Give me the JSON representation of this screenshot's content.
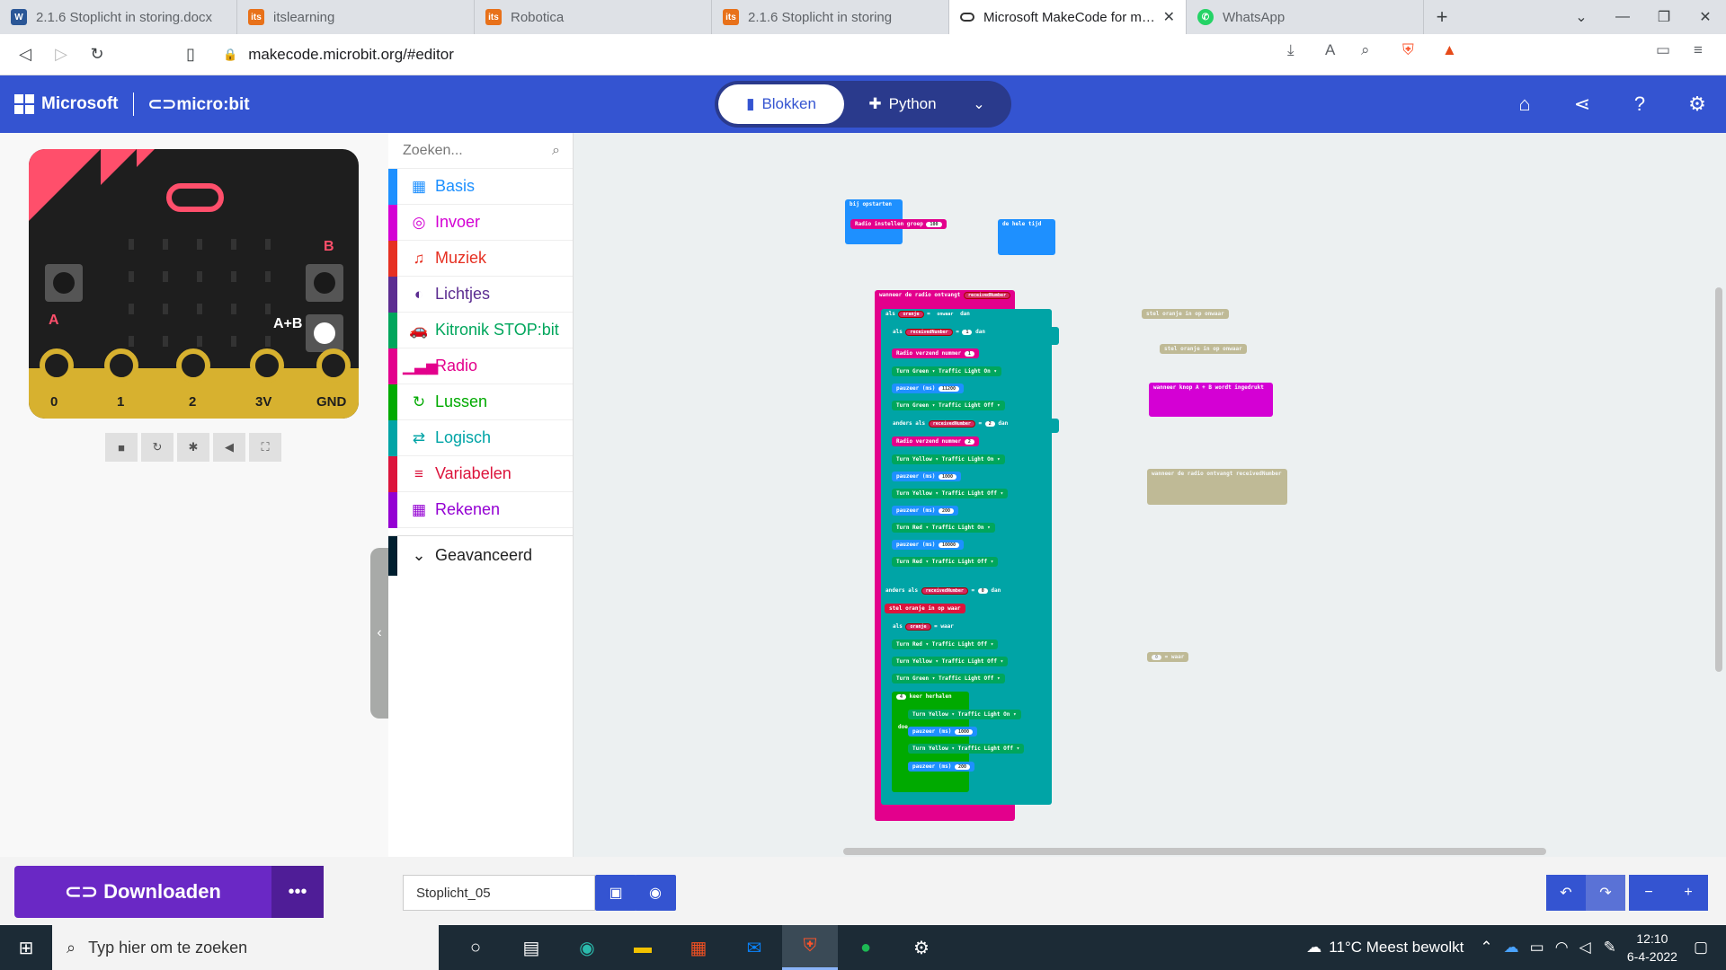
{
  "browser": {
    "tabs": [
      {
        "title": "2.1.6 Stoplicht in storing.docx",
        "icon": "W",
        "color": "#2b5797"
      },
      {
        "title": "itslearning",
        "icon": "its",
        "color": "#e8711a"
      },
      {
        "title": "Robotica",
        "icon": "its",
        "color": "#e8711a"
      },
      {
        "title": "2.1.6 Stoplicht in storing",
        "icon": "its",
        "color": "#e8711a"
      },
      {
        "title": "Microsoft MakeCode for micro:bit",
        "icon": "mc",
        "color": "#fff",
        "active": true
      },
      {
        "title": "WhatsApp",
        "icon": "wa",
        "color": "#25d366"
      }
    ],
    "url": "makecode.microbit.org/#editor"
  },
  "header": {
    "microsoft": "Microsoft",
    "microbit": "micro:bit",
    "blocks_label": "Blokken",
    "python_label": "Python"
  },
  "simulator": {
    "pin_labels": [
      "0",
      "1",
      "2",
      "3V",
      "GND"
    ],
    "button_a": "A",
    "button_b": "B",
    "button_ab": "A+B"
  },
  "toolbox": {
    "search_placeholder": "Zoeken...",
    "categories": [
      {
        "label": "Basis",
        "color": "#1e90ff",
        "icon": "grid-icon"
      },
      {
        "label": "Invoer",
        "color": "#d400d4",
        "icon": "target-icon"
      },
      {
        "label": "Muziek",
        "color": "#e63022",
        "icon": "headphones-icon"
      },
      {
        "label": "Lichtjes",
        "color": "#5c2d91",
        "icon": "toggle-icon"
      },
      {
        "label": "Kitronik STOP:bit",
        "color": "#00a65c",
        "icon": "car-icon"
      },
      {
        "label": "Radio",
        "color": "#e3008c",
        "icon": "signal-icon"
      },
      {
        "label": "Lussen",
        "color": "#00aa00",
        "icon": "loop-icon"
      },
      {
        "label": "Logisch",
        "color": "#00a4a6",
        "icon": "shuffle-icon"
      },
      {
        "label": "Variabelen",
        "color": "#dc143c",
        "icon": "lines-icon"
      },
      {
        "label": "Rekenen",
        "color": "#9400d3",
        "icon": "calculator-icon"
      }
    ],
    "advanced": "Geavanceerd"
  },
  "workspace": {
    "start_block": "bij opstarten",
    "radio_group": "Radio instellen groep",
    "radio_group_value": "100",
    "forever_block": "de hele tijd",
    "on_radio": "wanneer de radio ontvangt",
    "received": "receivedNumber",
    "als": "als",
    "dan": "dan",
    "anders_als": "anders als",
    "oranje": "oranje",
    "onwaar": "onwaar",
    "waar": "waar",
    "radio_send": "Radio verzend nummer",
    "pause": "pauzeer (ms)",
    "stel": "stel",
    "in_op": "in op",
    "repeat": "keer herhalen",
    "doe": "doe",
    "on_button": "wanneer knop  A + B  wordt ingedrukt",
    "turn_lines": [
      "Turn  Green ▾  Traffic Light  On ▾",
      "Turn  Green ▾  Traffic Light  Off ▾",
      "Turn  Yellow ▾  Traffic Light  On ▾",
      "Turn  Yellow ▾  Traffic Light  Off ▾",
      "Turn  Red ▾  Traffic Light  On ▾",
      "Turn  Red ▾  Traffic Light  Off ▾"
    ],
    "values": {
      "v1": "1",
      "v0": "0",
      "p11200": "11200",
      "p1000": "1000",
      "p200": "200",
      "p10000": "10000",
      "v4": "4",
      "v2": "2"
    }
  },
  "editor": {
    "download": "Downloaden",
    "project_name": "Stoplicht_05"
  },
  "taskbar": {
    "search_placeholder": "Typ hier om te zoeken",
    "weather": "11°C  Meest bewolkt",
    "time": "12:10",
    "date": "6-4-2022"
  }
}
